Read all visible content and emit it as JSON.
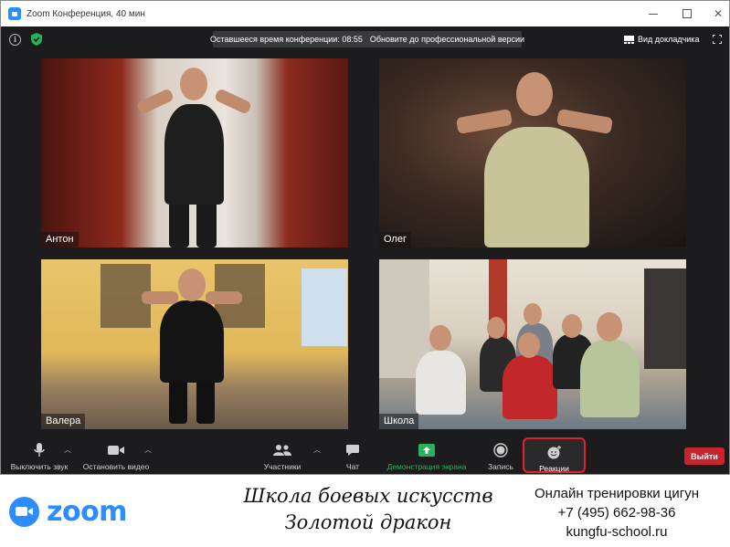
{
  "window": {
    "title": "Zoom Конференция, 40 мин"
  },
  "topbar": {
    "timer_text": "Оставшееся время конференции: 08:55",
    "upgrade_text": "Обновите до профессиональной версии",
    "speaker_view_label": "Вид докладчика"
  },
  "participants": [
    {
      "name": "Антон"
    },
    {
      "name": "Олег"
    },
    {
      "name": "Валера"
    },
    {
      "name": "Школа"
    }
  ],
  "toolbar": {
    "unmute_label": "Выключить звук",
    "stop_video_label": "Остановить видео",
    "participants_label": "Участники",
    "chat_label": "Чат",
    "share_label": "Демонстрация экрана",
    "record_label": "Запись",
    "reactions_label": "Реакции",
    "leave_label": "Выйти"
  },
  "footer": {
    "logo_text": "zoom",
    "school_line1": "Школа боевых искусств",
    "school_line2": "Золотой дракон",
    "contact_line1": "Онлайн тренировки цигун",
    "contact_line2": "+7 (495) 662-98-36",
    "contact_line3": "kungfu-school.ru"
  },
  "colors": {
    "zoom_blue": "#2d8cff",
    "leave_red": "#c7252d",
    "share_green": "#25b35b",
    "highlight_red": "#e0222f"
  }
}
